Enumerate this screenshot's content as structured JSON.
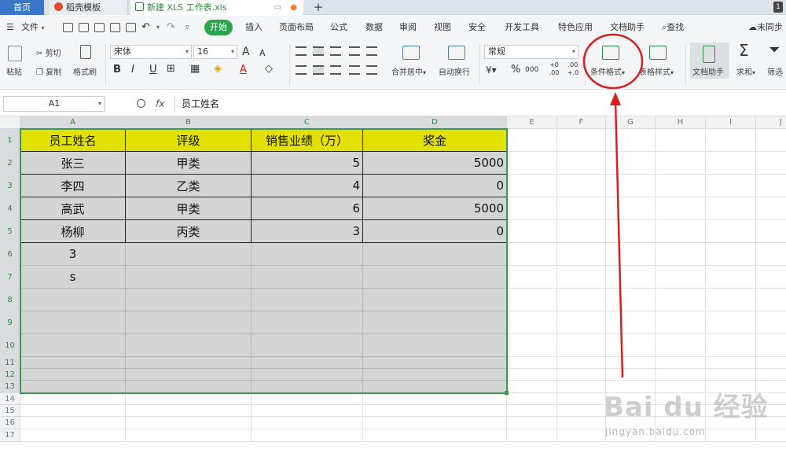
{
  "tabs": {
    "home": "首页",
    "template": "稻壳模板",
    "file": "新建 XLS 工作表.xls",
    "new_tab": "+",
    "badge": "1"
  },
  "menu": {
    "file": "文件",
    "start": "开始",
    "insert": "插入",
    "page_layout": "页面布局",
    "formula": "公式",
    "data": "数据",
    "review": "审阅",
    "view": "视图",
    "security": "安全",
    "developer": "开发工具",
    "special": "特色应用",
    "doc_assistant": "文档助手",
    "search": "查找",
    "sync": "未同步"
  },
  "ribbon": {
    "paste": "粘贴",
    "cut": "剪切",
    "copy": "复制",
    "format_painter": "格式刷",
    "font_name": "宋体",
    "font_size": "16",
    "bold": "B",
    "italic": "I",
    "underline": "U",
    "grow_font": "A",
    "shrink_font": "A",
    "font_color": "A",
    "merge_center": "合并居中",
    "wrap_text": "自动换行",
    "number_format": "常规",
    "percent": "%",
    "thousands": "000",
    "inc_decimal": "+0 .00",
    "dec_decimal": ".00 +.0",
    "conditional_format": "条件格式",
    "table_style": "表格样式",
    "doc_helper": "文档助手",
    "sum": "求和",
    "filter": "筛选",
    "sigma": "Σ"
  },
  "formula_bar": {
    "name_box": "A1",
    "fx": "fx",
    "content": "员工姓名"
  },
  "sheet": {
    "columns": [
      "A",
      "B",
      "C",
      "D",
      "E",
      "F",
      "G",
      "H",
      "I",
      "J"
    ],
    "rows": [
      "1",
      "2",
      "3",
      "4",
      "5",
      "6",
      "7",
      "8",
      "9",
      "10",
      "11",
      "12",
      "13",
      "14",
      "15",
      "16",
      "17"
    ],
    "header": [
      "员工姓名",
      "评级",
      "销售业绩（万）",
      "奖金"
    ],
    "data": [
      [
        "张三",
        "甲类",
        "5",
        "5000"
      ],
      [
        "李四",
        "乙类",
        "4",
        "0"
      ],
      [
        "高武",
        "甲类",
        "6",
        "5000"
      ],
      [
        "杨柳",
        "丙类",
        "3",
        "0"
      ],
      [
        "3",
        "",
        "",
        ""
      ],
      [
        "s",
        "",
        "",
        ""
      ]
    ]
  },
  "colors": {
    "header_fill": "#e1e000",
    "selection_fill": "#d4d4d4",
    "selection_border": "#3e9a4a",
    "annotation": "#d42020",
    "start_tab": "#2ba44a"
  },
  "watermark": {
    "main": "Bai du 经验",
    "sub": "jingyan.baidu.com"
  }
}
